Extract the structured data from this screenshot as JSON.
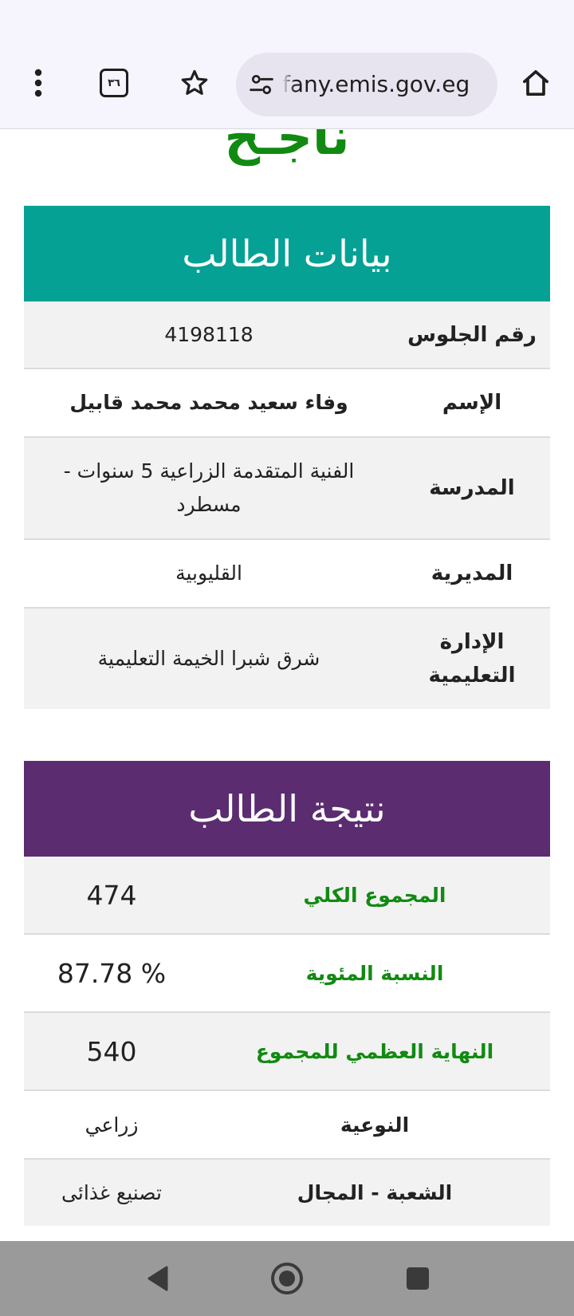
{
  "browser": {
    "url": "fany.emis.gov.eg",
    "tab_count": "٣٦",
    "icons": [
      "more-vert-icon",
      "tab-switcher-icon",
      "bookmark-star-icon",
      "site-settings-icon",
      "home-icon"
    ]
  },
  "page": {
    "status": "ناجـح",
    "student_section": {
      "title": "بيانات الطالب",
      "rows": [
        {
          "label": "رقم الجلوس",
          "value": "4198118"
        },
        {
          "label": "الإسم",
          "value": "وفاء سعيد محمد محمد قابيل"
        },
        {
          "label": "المدرسة",
          "value": "الفنية المتقدمة الزراعية 5 سنوات - مسطرد"
        },
        {
          "label": "المديرية",
          "value": "القليوبية"
        },
        {
          "label": "الإدارة التعليمية",
          "value": "شرق شبرا الخيمة التعليمية"
        }
      ]
    },
    "result_section": {
      "title": "نتيجة الطالب",
      "rows": [
        {
          "label": "المجموع الكلي",
          "value": "474"
        },
        {
          "label": "النسبة المئوية",
          "value": "87.78 %"
        },
        {
          "label": "النهاية العظمي للمجموع",
          "value": "540"
        },
        {
          "label": "النوعية",
          "value": "زراعي"
        },
        {
          "label": "الشعبة - المجال",
          "value": "تصنيع غذائى"
        }
      ]
    }
  },
  "colors": {
    "status_green": "#128a12",
    "student_header_bg": "#06a195",
    "result_header_bg": "#5b2c6f",
    "nav_bar_bg": "#9a9a9a"
  },
  "system_nav": {
    "icons": [
      "back-icon",
      "home-circle-icon",
      "recent-apps-icon"
    ]
  }
}
